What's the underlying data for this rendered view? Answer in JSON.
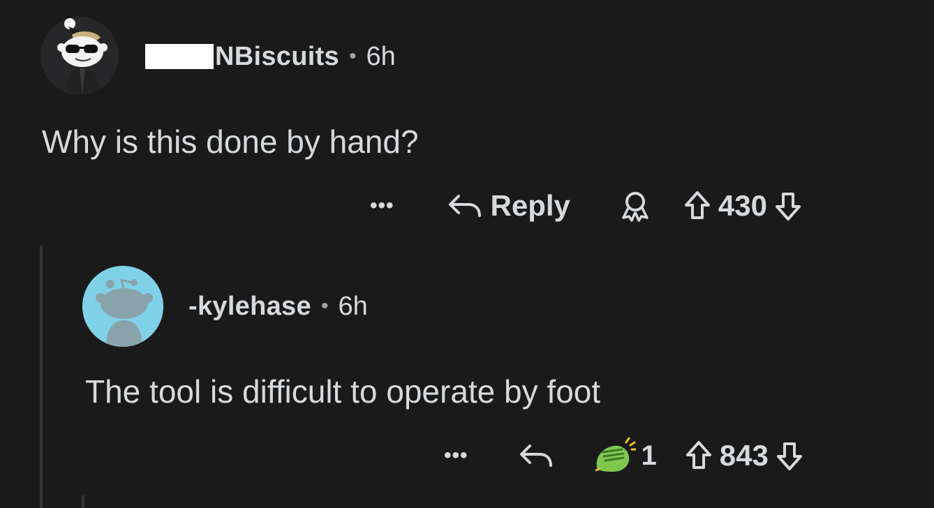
{
  "parent_comment": {
    "username": "NBiscuits",
    "separator": "•",
    "time": "6h",
    "body": "Why is this done by hand?",
    "actions": {
      "more_label": "•••",
      "reply_label": "Reply",
      "upvotes": "430"
    },
    "avatar_icon": "snoo-sunglasses-avatar"
  },
  "reply_comment": {
    "username": "-kylehase",
    "separator": "•",
    "time": "6h",
    "body": "The tool is difficult to operate by foot",
    "actions": {
      "more_label": "•••",
      "award_count": "1",
      "upvotes": "843"
    },
    "avatar_icon": "snoo-default-avatar",
    "avatar_color": "#7fd1e8"
  },
  "colors": {
    "background": "#1a1a1b",
    "text": "#d7dadc",
    "thread_line": "#343536"
  }
}
